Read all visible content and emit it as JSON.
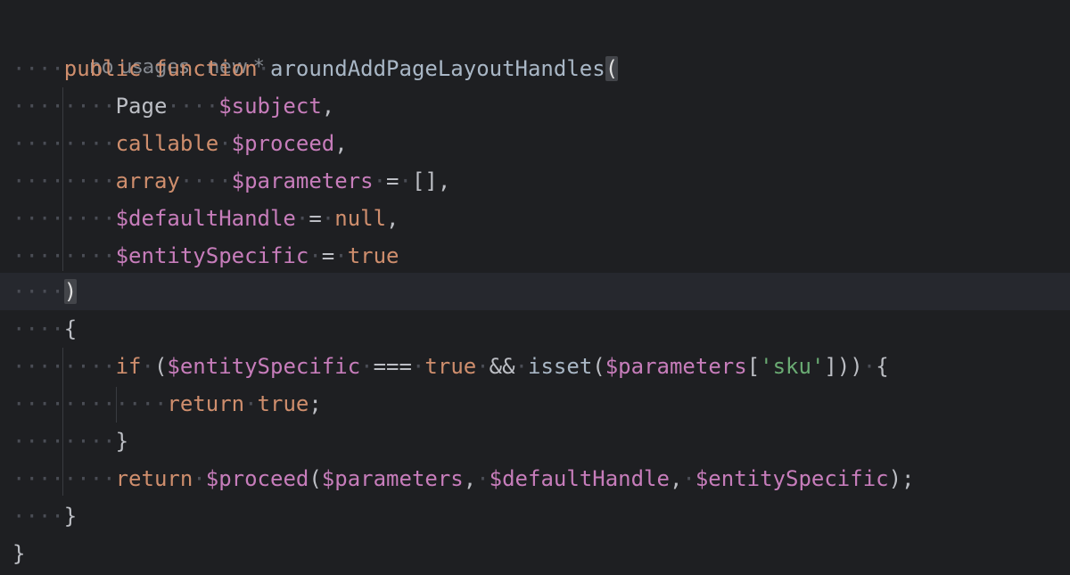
{
  "hint": {
    "usages": "no usages",
    "status": "new *"
  },
  "code": {
    "top_brace": "{",
    "l_public": "public",
    "l_function": "function",
    "l_name": "aroundAddPageLayoutHandles",
    "l_open": "(",
    "p1_type": "Page",
    "p1_var": "$subject",
    "p1_comma": ",",
    "p2_type": "callable",
    "p2_var": "$proceed",
    "p2_comma": ",",
    "p3_type": "array",
    "p3_var": "$parameters",
    "p3_eq": "=",
    "p3_val": "[],",
    "p4_var": "$defaultHandle",
    "p4_eq": "=",
    "p4_val": "null",
    "p4_comma": ",",
    "p5_var": "$entitySpecific",
    "p5_eq": "=",
    "p5_val": "true",
    "close_paren": ")",
    "open_brace": "{",
    "if_kw": "if",
    "if_open": "(",
    "if_var": "$entitySpecific",
    "if_op": "===",
    "if_true": "true",
    "if_and": "&&",
    "if_isset": "isset",
    "if_p_open": "(",
    "if_params": "$parameters",
    "if_br_open": "[",
    "if_key": "'sku'",
    "if_br_close": "]))",
    "if_brace": "{",
    "ret_kw": "return",
    "ret_val": "true",
    "ret_semi": ";",
    "if_close": "}",
    "r2_kw": "return",
    "r2_fn": "$proceed",
    "r2_open": "(",
    "r2_a1": "$parameters",
    "r2_c1": ",",
    "r2_a2": "$defaultHandle",
    "r2_c2": ",",
    "r2_a3": "$entitySpecific",
    "r2_close": ");",
    "fn_close": "}",
    "class_close": "}"
  }
}
